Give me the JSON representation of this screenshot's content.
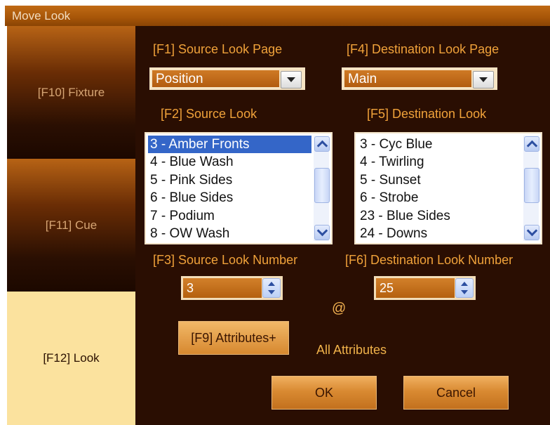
{
  "window": {
    "title": "Move Look"
  },
  "sidebar": {
    "items": [
      {
        "label": "[F10] Fixture"
      },
      {
        "label": "[F11] Cue"
      },
      {
        "label": "[F12] Look"
      }
    ]
  },
  "source": {
    "page_label": "[F1] Source Look Page",
    "page_value": "Position",
    "look_label": "[F2] Source Look",
    "looks": [
      "3 - Amber Fronts",
      "4 - Blue Wash",
      "5 - Pink Sides",
      "6 - Blue Sides",
      "7 - Podium",
      "8 - OW Wash"
    ],
    "number_label": "[F3] Source Look Number",
    "number_value": "3"
  },
  "destination": {
    "page_label": "[F4] Destination Look Page",
    "page_value": "Main",
    "look_label": "[F5] Destination Look",
    "looks": [
      "3 - Cyc Blue",
      "4 - Twirling",
      "5 - Sunset",
      "6 - Strobe",
      "23 - Blue Sides",
      "24 - Downs"
    ],
    "number_label": "[F6] Destination Look Number",
    "number_value": "25"
  },
  "at_symbol": "@",
  "attributes": {
    "button_label": "[F9] Attributes+",
    "status": "All Attributes"
  },
  "footer": {
    "ok_label": "OK",
    "cancel_label": "Cancel"
  },
  "colors": {
    "accent": "#f0a23a",
    "selection": "#3466c8",
    "background": "#2a0e02"
  }
}
